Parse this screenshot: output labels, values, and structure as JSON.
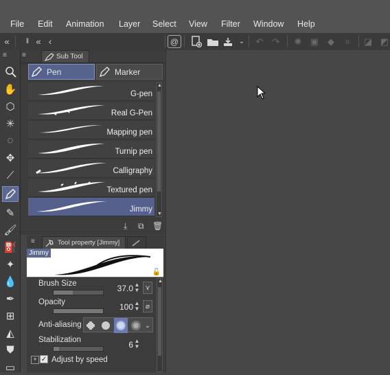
{
  "menu": [
    "File",
    "Edit",
    "Animation",
    "Layer",
    "Select",
    "View",
    "Filter",
    "Window",
    "Help"
  ],
  "subtool": {
    "tab_title": "Sub Tool",
    "groups": [
      {
        "label": "Pen",
        "selected": true
      },
      {
        "label": "Marker",
        "selected": false
      }
    ],
    "brushes": [
      {
        "label": "G-pen"
      },
      {
        "label": "Real G-Pen"
      },
      {
        "label": "Mapping pen"
      },
      {
        "label": "Turnip pen"
      },
      {
        "label": "Calligraphy"
      },
      {
        "label": "Textured pen"
      },
      {
        "label": "Jimmy",
        "selected": true
      }
    ]
  },
  "tool_property": {
    "tab_title": "Tool property [Jimmy]",
    "preview_name": "Jimmy",
    "brush_size": {
      "label": "Brush Size",
      "value": "37.0"
    },
    "opacity": {
      "label": "Opacity",
      "value": "100"
    },
    "anti_aliasing": {
      "label": "Anti-aliasing"
    },
    "stabilization": {
      "label": "Stabilization",
      "value": "6"
    },
    "adjust_by_speed": {
      "label": "Adjust by speed",
      "checked": true
    }
  },
  "colors": {
    "selection": "#55608c",
    "panel_bg": "#3c3c3c",
    "menubar_bg": "#535353"
  }
}
